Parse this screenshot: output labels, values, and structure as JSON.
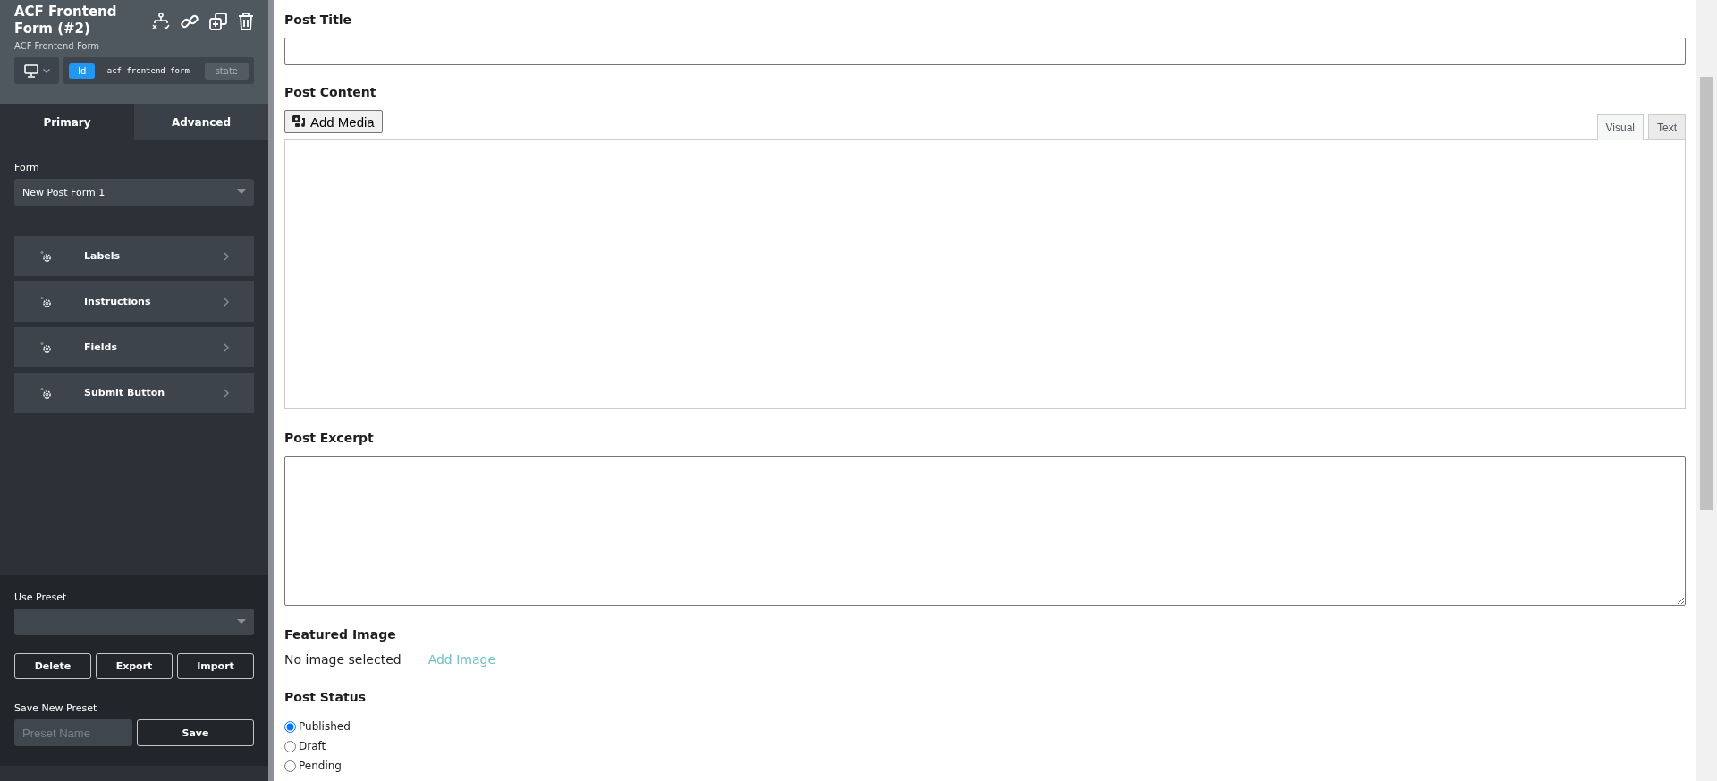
{
  "sidebar": {
    "header": {
      "title": "ACF Frontend Form (#2)",
      "subtitle": "ACF Frontend Form",
      "id_badge": "Id",
      "id_value": "-acf-frontend-form-",
      "state_button": "state"
    },
    "tabs": [
      {
        "label": "Primary",
        "selected": true
      },
      {
        "label": "Advanced",
        "selected": false
      }
    ],
    "form_field": {
      "label": "Form",
      "value": "New Post Form 1"
    },
    "sections": [
      {
        "label": "Labels"
      },
      {
        "label": "Instructions"
      },
      {
        "label": "Fields"
      },
      {
        "label": "Submit Button"
      }
    ],
    "presets": {
      "label": "Use Preset",
      "buttons": [
        "Delete",
        "Export",
        "Import"
      ],
      "save_label": "Save New Preset",
      "name_placeholder": "Preset Name",
      "save_button": "Save"
    }
  },
  "form": {
    "post_title": {
      "label": "Post Title"
    },
    "post_content": {
      "label": "Post Content",
      "add_media": "Add Media",
      "editor_tabs": [
        {
          "label": "Visual",
          "selected": true
        },
        {
          "label": "Text",
          "selected": false
        }
      ]
    },
    "post_excerpt": {
      "label": "Post Excerpt"
    },
    "featured_image": {
      "label": "Featured Image",
      "status": "No image selected",
      "link": "Add Image"
    },
    "post_status": {
      "label": "Post Status",
      "options": [
        {
          "label": "Published",
          "selected": true
        },
        {
          "label": "Draft",
          "selected": false
        },
        {
          "label": "Pending",
          "selected": false
        }
      ]
    }
  }
}
